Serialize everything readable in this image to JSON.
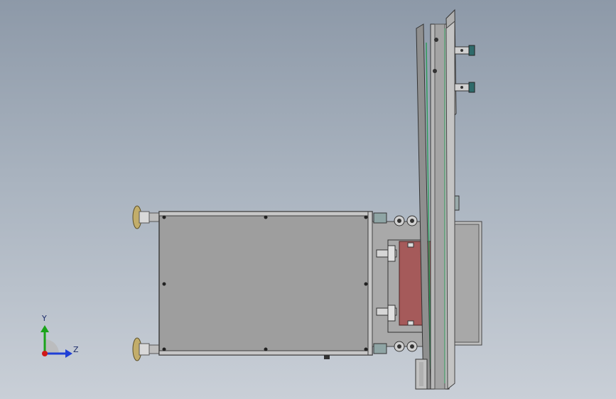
{
  "viewport": {
    "background_top": "#8d99a8",
    "background_bottom": "#c9cfd7"
  },
  "triad": {
    "y_label": "Y",
    "z_label": "Z",
    "y_color": "#1aa31a",
    "z_color": "#1f3fd6",
    "x_color": "#d01818"
  },
  "model": {
    "housing_color": "#9e9e9e",
    "frame_color": "#b3b3b3",
    "rail_color": "#b8b8b8",
    "plate_color": "#a55a5a",
    "foot_color": "#c2ad6a",
    "accent_color": "#2f9a5a"
  }
}
